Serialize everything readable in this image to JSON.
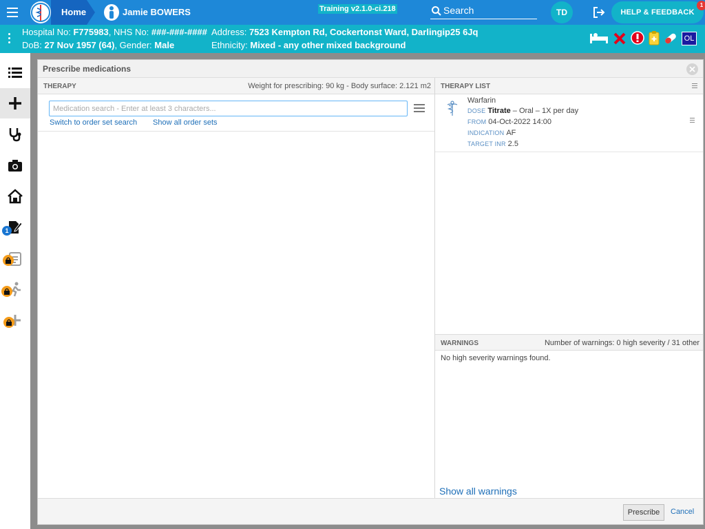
{
  "topbar": {
    "home_label": "Home",
    "patient_name": "Jamie BOWERS",
    "version": "Training v2.1.0-ci.218",
    "search_label": "Search",
    "user_initials": "TD",
    "help_label": "HELP & FEEDBACK",
    "help_badge": "1"
  },
  "banner": {
    "hospital_no_label": "Hospital No:",
    "hospital_no": "F775983",
    "nhs_no_label": "NHS No:",
    "nhs_no": "###-###-####",
    "address_label": "Address:",
    "address": "7523 Kempton Rd, Cockertonst Ward, Darlingip25 6Jq",
    "dob_label": "DoB:",
    "dob": "27 Nov 1957 (64)",
    "gender_label": "Gender:",
    "gender": "Male",
    "ethnicity_label": "Ethnicity:",
    "ethnicity": "Mixed - any other mixed background",
    "ol_label": "OL"
  },
  "rail": {
    "badge": "1"
  },
  "modal": {
    "title": "Prescribe medications",
    "therapy": {
      "header": "THERAPY",
      "weight_info": "Weight for prescribing: 90 kg - Body surface: 2.121 m2",
      "search_placeholder": "Medication search - Enter at least 3 characters...",
      "link_order_set": "Switch to order set search",
      "link_show_all": "Show all order sets"
    },
    "therapy_list": {
      "header": "THERAPY LIST",
      "items": [
        {
          "name": "Warfarin",
          "dose_label": "DOSE",
          "dose_value": "Titrate",
          "dose_detail": " – Oral – 1X per day",
          "from_label": "FROM",
          "from_value": "04-Oct-2022 14:00",
          "indication_label": "INDICATION",
          "indication_value": "AF",
          "target_label": "TARGET INR",
          "target_value": "2.5"
        }
      ]
    },
    "warnings": {
      "header": "WARNINGS",
      "count": "Number of warnings: 0 high severity / 31 other",
      "message": "No high severity warnings found.",
      "show_all": "Show all warnings"
    },
    "footer": {
      "prescribe": "Prescribe",
      "cancel": "Cancel"
    }
  },
  "colors": {
    "topbar": "#1e88d8",
    "banner": "#12b3c9",
    "link": "#1e6fb8"
  }
}
